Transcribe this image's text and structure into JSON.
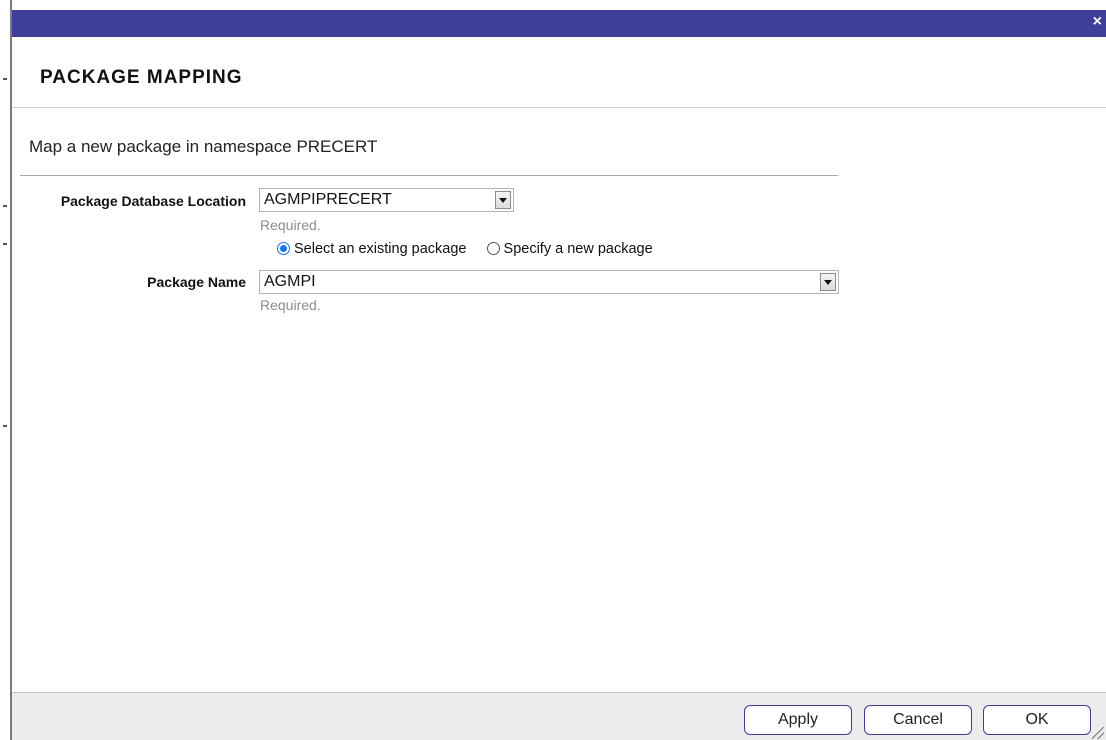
{
  "dialog": {
    "title": "PACKAGE MAPPING",
    "close_glyph": "×",
    "subtitle": "Map a new package in namespace PRECERT"
  },
  "form": {
    "location": {
      "label": "Package Database Location",
      "value": "AGMPIPRECERT",
      "hint": "Required."
    },
    "mode_options": [
      {
        "label": "Select an existing package",
        "selected": true
      },
      {
        "label": "Specify a new package",
        "selected": false
      }
    ],
    "package_name": {
      "label": "Package Name",
      "value": "AGMPI",
      "hint": "Required."
    }
  },
  "footer": {
    "apply_label": "Apply",
    "cancel_label": "Cancel",
    "ok_label": "OK"
  },
  "colors": {
    "titlebar": "#3f3f9a",
    "radio_accent": "#1a73e8",
    "hint_text": "#8c8c8c"
  }
}
